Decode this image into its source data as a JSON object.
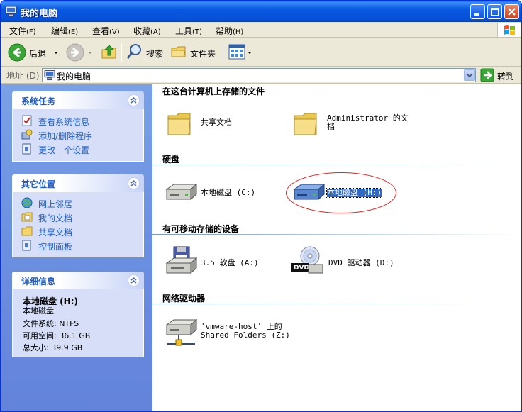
{
  "window": {
    "title": "我的电脑"
  },
  "menubar": {
    "items": [
      {
        "label": "文件",
        "acc": "(F)"
      },
      {
        "label": "编辑",
        "acc": "(E)"
      },
      {
        "label": "查看",
        "acc": "(V)"
      },
      {
        "label": "收藏",
        "acc": "(A)"
      },
      {
        "label": "工具",
        "acc": "(T)"
      },
      {
        "label": "帮助",
        "acc": "(H)"
      }
    ]
  },
  "toolbar": {
    "back_label": "后退",
    "search_label": "搜索",
    "folders_label": "文件夹"
  },
  "address": {
    "label": "地址 (D)",
    "value": "我的电脑",
    "go_label": "转到"
  },
  "sidebar": {
    "system_tasks": {
      "title": "系统任务",
      "items": [
        {
          "label": "查看系统信息",
          "icon": "system-info-icon"
        },
        {
          "label": "添加/删除程序",
          "icon": "add-remove-programs-icon"
        },
        {
          "label": "更改一个设置",
          "icon": "control-panel-icon"
        }
      ]
    },
    "other_places": {
      "title": "其它位置",
      "items": [
        {
          "label": "网上邻居",
          "icon": "network-places-icon"
        },
        {
          "label": "我的文档",
          "icon": "my-documents-icon"
        },
        {
          "label": "共享文档",
          "icon": "shared-documents-icon"
        },
        {
          "label": "控制面板",
          "icon": "control-panel-icon"
        }
      ]
    },
    "details": {
      "title": "详细信息",
      "name": "本地磁盘 (H:)",
      "type": "本地磁盘",
      "filesystem": "文件系统: NTFS",
      "free": "可用空间: 36.1 GB",
      "total": "总大小: 39.9 GB"
    }
  },
  "content": {
    "groups": [
      {
        "header": "在这台计算机上存储的文件",
        "items": [
          {
            "label": "共享文档",
            "icon": "folder-icon"
          },
          {
            "label": "Administrator 的文\n档",
            "icon": "folder-icon"
          }
        ]
      },
      {
        "header": "硬盘",
        "items": [
          {
            "label": "本地磁盘 (C:)",
            "icon": "hard-drive-icon"
          },
          {
            "label": "本地磁盘 (H:)",
            "icon": "hard-drive-icon",
            "selected": true
          }
        ]
      },
      {
        "header": "有可移动存储的设备",
        "items": [
          {
            "label": "3.5 软盘 (A:)",
            "icon": "floppy-drive-icon"
          },
          {
            "label": "DVD 驱动器 (D:)",
            "icon": "dvd-drive-icon"
          }
        ]
      },
      {
        "header": "网络驱动器",
        "items": [
          {
            "label": "'vmware-host' 上的\nShared Folders (Z:)",
            "icon": "network-drive-icon"
          }
        ]
      }
    ]
  },
  "colors": {
    "title_bar": "#0859e0",
    "sidebar_bg": "#6b8fe0",
    "panel_title": "#215dc6",
    "selection": "#316ac5",
    "annotation": "#e02020"
  }
}
